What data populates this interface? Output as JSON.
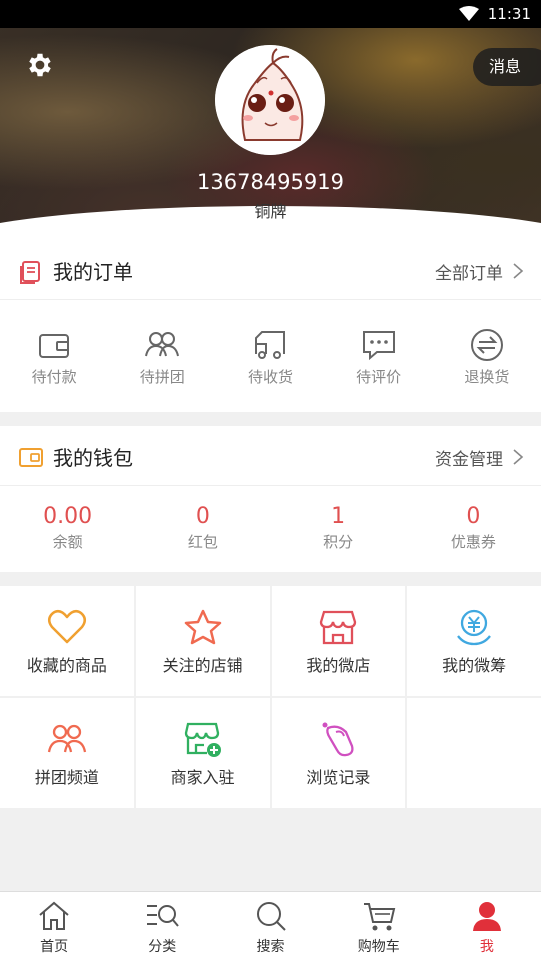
{
  "status_bar": {
    "time": "11:31"
  },
  "header": {
    "message_label": "消息",
    "phone": "13678495919",
    "level": "铜牌"
  },
  "orders": {
    "title": "我的订单",
    "more": "全部订单",
    "items": [
      {
        "label": "待付款",
        "icon": "wallet-icon"
      },
      {
        "label": "待拼团",
        "icon": "group-icon"
      },
      {
        "label": "待收货",
        "icon": "truck-icon"
      },
      {
        "label": "待评价",
        "icon": "comment-icon"
      },
      {
        "label": "退换货",
        "icon": "exchange-icon"
      }
    ]
  },
  "wallet": {
    "title": "我的钱包",
    "more": "资金管理",
    "items": [
      {
        "value": "0.00",
        "label": "余额"
      },
      {
        "value": "0",
        "label": "红包"
      },
      {
        "value": "1",
        "label": "积分"
      },
      {
        "value": "0",
        "label": "优惠券"
      }
    ]
  },
  "services": [
    {
      "label": "收藏的商品",
      "icon": "heart-icon",
      "color": "#f0a030"
    },
    {
      "label": "关注的店铺",
      "icon": "star-icon",
      "color": "#f06a50"
    },
    {
      "label": "我的微店",
      "icon": "shop-icon",
      "color": "#e0505a"
    },
    {
      "label": "我的微筹",
      "icon": "yuan-icon",
      "color": "#40a8e0"
    },
    {
      "label": "拼团频道",
      "icon": "group-icon",
      "color": "#f06a50"
    },
    {
      "label": "商家入驻",
      "icon": "store-add-icon",
      "color": "#30b060"
    },
    {
      "label": "浏览记录",
      "icon": "history-icon",
      "color": "#d050c0"
    }
  ],
  "tabs": [
    {
      "label": "首页",
      "icon": "home-icon",
      "active": false
    },
    {
      "label": "分类",
      "icon": "category-icon",
      "active": false
    },
    {
      "label": "搜索",
      "icon": "search-icon",
      "active": false
    },
    {
      "label": "购物车",
      "icon": "cart-icon",
      "active": false
    },
    {
      "label": "我",
      "icon": "user-icon",
      "active": true
    }
  ],
  "colors": {
    "accent": "#e0303a",
    "number": "#e05050"
  }
}
